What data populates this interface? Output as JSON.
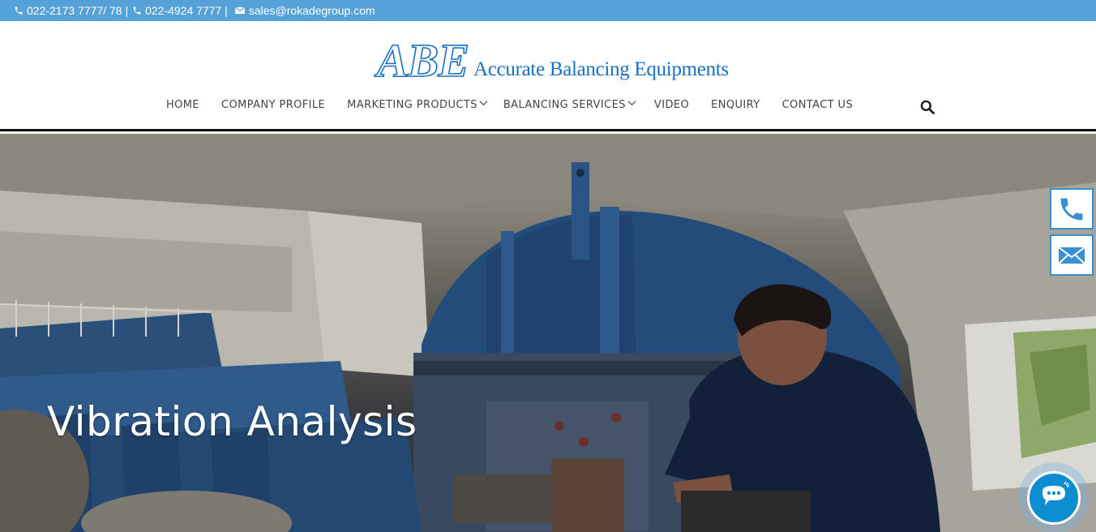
{
  "topbar": {
    "phone1": "022-2173 7777/ 78 |",
    "phone2": "022-4924 7777 |",
    "email": "sales@rokadegroup.com"
  },
  "logo": {
    "mark": "ABE",
    "text": "Accurate Balancing Equipments"
  },
  "nav": {
    "items": [
      {
        "label": "HOME",
        "dropdown": false
      },
      {
        "label": "COMPANY PROFILE",
        "dropdown": false
      },
      {
        "label": "MARKETING PRODUCTS",
        "dropdown": true
      },
      {
        "label": "BALANCING SERVICES",
        "dropdown": true
      },
      {
        "label": "VIDEO",
        "dropdown": false
      },
      {
        "label": "ENQUIRY",
        "dropdown": false
      },
      {
        "label": "CONTACT US",
        "dropdown": false
      }
    ]
  },
  "hero": {
    "title": "Vibration Analysis"
  },
  "colors": {
    "topbar": "#55a2d9",
    "brand": "#1a6fc0",
    "accent": "#0d8ed0"
  },
  "icons": {
    "phone": "phone-icon",
    "email": "envelope-icon",
    "search": "search-icon",
    "chat": "chat-icon"
  }
}
